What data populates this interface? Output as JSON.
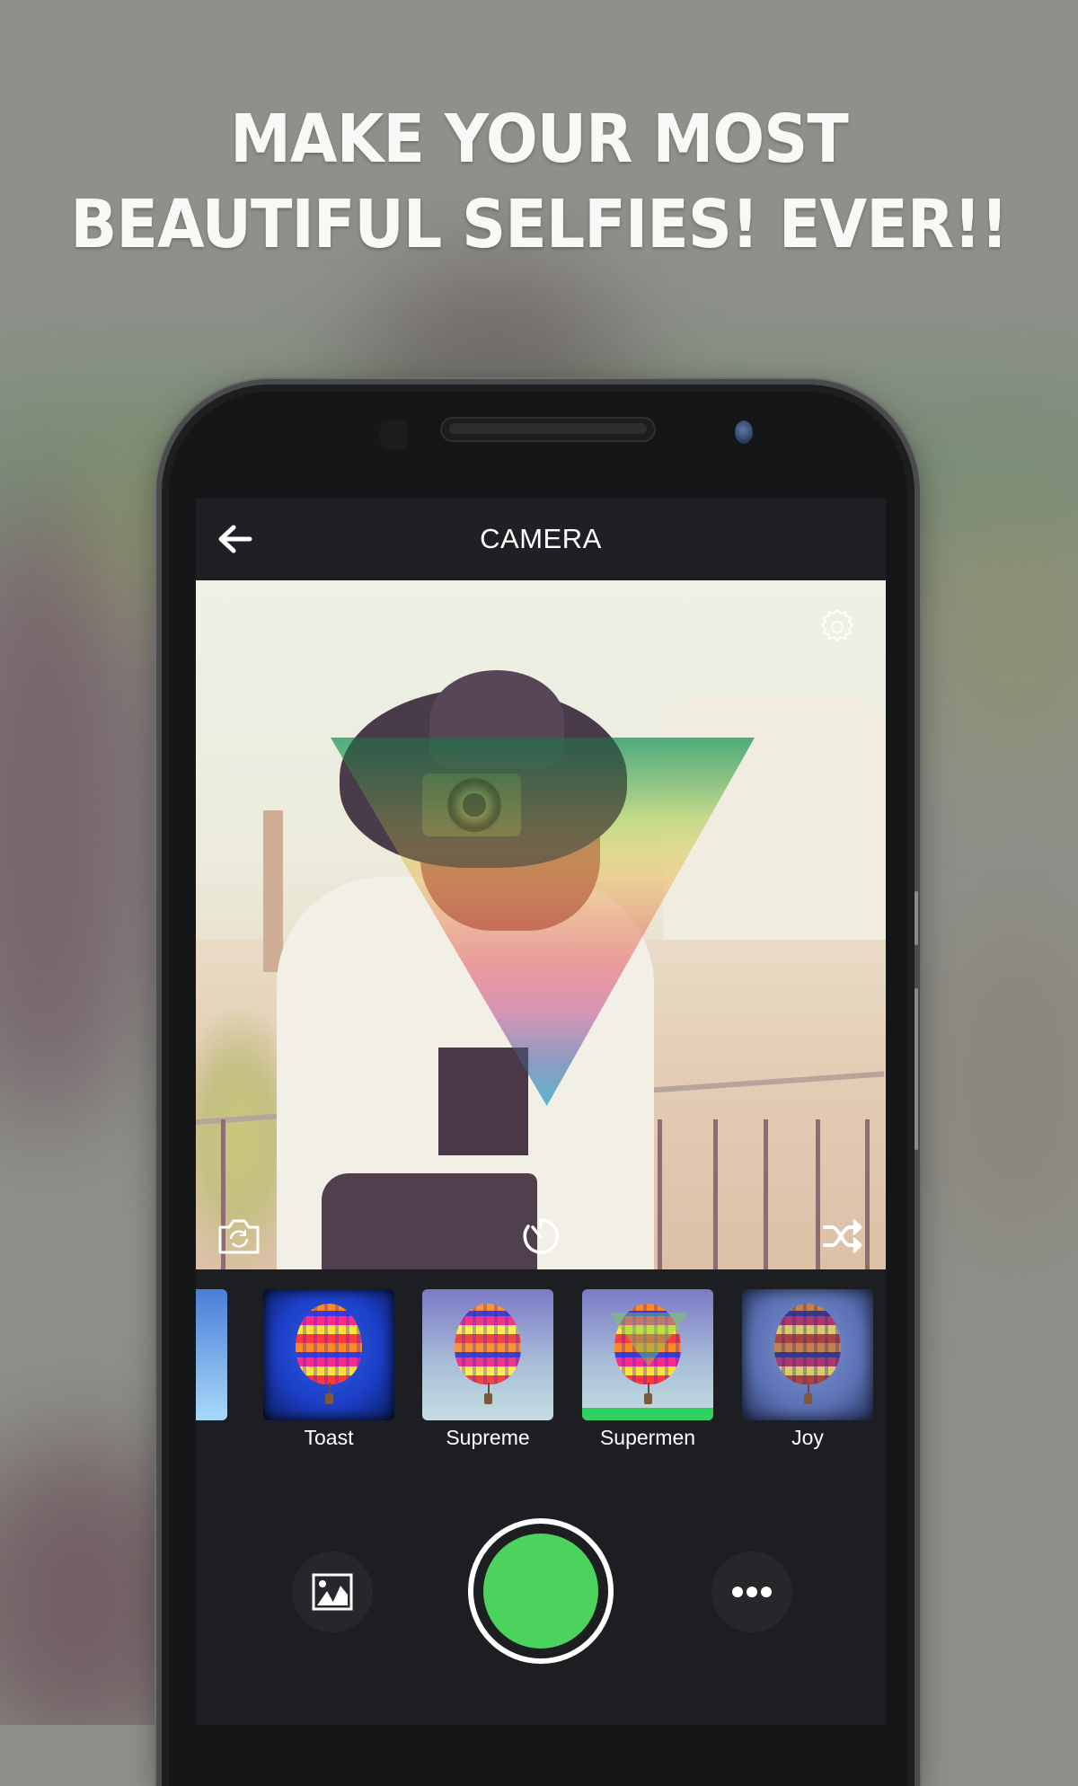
{
  "promo": {
    "headline_line1": "MAKE YOUR MOST",
    "headline_line2": "BEAUTIFUL SELFIES! EVER!!"
  },
  "appbar": {
    "title": "CAMERA",
    "back_icon": "arrow-left-icon"
  },
  "preview": {
    "overlay_icons": {
      "settings": "gear-icon",
      "flip_camera": "camera-switch-icon",
      "timer": "timer-icon",
      "shuffle": "shuffle-icon"
    },
    "overlay_effect": "gradient-triangle"
  },
  "filters": {
    "items": [
      {
        "label": "",
        "selected": false,
        "partial": true
      },
      {
        "label": "Toast",
        "selected": false
      },
      {
        "label": "Supreme",
        "selected": false
      },
      {
        "label": "Supermen",
        "selected": true
      },
      {
        "label": "Joy",
        "selected": false
      }
    ],
    "selected_color": "#2fd160"
  },
  "controls": {
    "gallery_icon": "image-gallery-icon",
    "shutter_color": "#4cd35e",
    "more_icon": "more-horizontal-icon"
  },
  "colors": {
    "screen_bg": "#1d1e21",
    "appbar_bg": "#1f2023",
    "text": "#ffffff"
  }
}
